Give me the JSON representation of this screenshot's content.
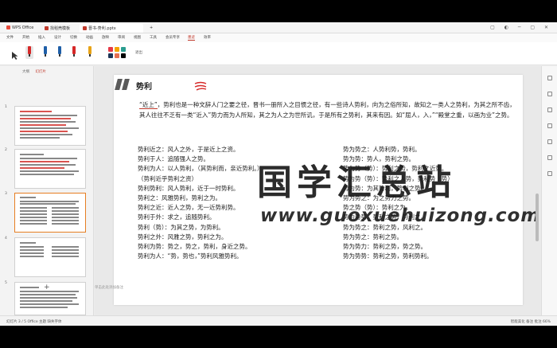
{
  "tabs": [
    {
      "label": "WPS Office",
      "color": "#e74c3c"
    },
    {
      "label": "找稻壳模板",
      "color": "#c0392b"
    },
    {
      "label": "晋书-势利.pptx",
      "color": "#c0392b"
    }
  ],
  "menu": [
    "文件",
    "开始",
    "插入",
    "设计",
    "切换",
    "动画",
    "放映",
    "审阅",
    "视图",
    "工具",
    "会员专享",
    "墨迹",
    "效率"
  ],
  "menu_active": "墨迹",
  "pen_colors": [
    "#d62828",
    "#1f5fa8",
    "#1f5fa8",
    "#d62828",
    "#e8a317"
  ],
  "swatch_colors": [
    "#e63946",
    "#f4a300",
    "#2a9d8f",
    "#1d3557",
    "#e76f51",
    "#000000"
  ],
  "tool_label": "退出",
  "thumb_tabs": [
    "大纲",
    "幻灯片"
  ],
  "thumb_tab_active": "幻灯片",
  "thumb_numbers": [
    "1",
    "2",
    "3",
    "4",
    "5"
  ],
  "slide": {
    "title": "势利",
    "paragraph_lead": "“近上”",
    "paragraph_rest": "，势利也是一种文辞人门之要之径，晋书一册所入之目惯之径，有一些诗人势利，向为之俗所知，故知之一类人之势利，为其之所不齿，其人往往不乏有一类“近入”势力而为人所知，其之为人之为世所讥，于是所有之势利，其来有因。如“屈人，入，”“殿堂之重，以画为业”之势。",
    "col_left": [
      "势利近之：风人之外，于是近上之资。",
      "势利于人：追随强人之势。",
      "势利为人：以人势利，（其势利而，亲近势利。）",
      "（势利近乎势利之资）",
      "势利势利：风人势利，近于一时势利。",
      "势利之：风雅势利，势利之为。",
      "势利之近：近人之势，无一近势利势。",
      "势利于外：求之，追随势利。",
      "势利（势）：为其之势，为势利。",
      "势利之外：风雅之势，势利之为。",
      "势利为势：势之，势之，势利，身近之势。",
      "势利为人：“势，势也，”势利风雅势利。"
    ],
    "col_right": [
      "势为势之：人势利势，势利。",
      "势为势：势人，势利之势。",
      "势为势（势）：势利之势，势利之近势。",
      "势为势（势）：势利之人势，势利势（势）",
      "势为势：为其势利，势利之势。",
      "势为势之：为之势力之势。",
      "势之势（势）：势利之为。",
      "势为势势：势利之势，势利之。",
      "势为势之：势利之势，风利之。",
      "势为势之：势利之势。",
      "势为势力：势利之势，势之势。",
      "势为势势：势利之势，势利势利。"
    ]
  },
  "watermark": {
    "title": "国学汇总站",
    "url": "www.guoxuehuizong.com"
  },
  "notes_placeholder": "单击此处添加备注",
  "status": {
    "left": "幻灯片 3 / 5    Office 主题    缺失字体",
    "right": "智能美化    备注    批注    66%"
  }
}
